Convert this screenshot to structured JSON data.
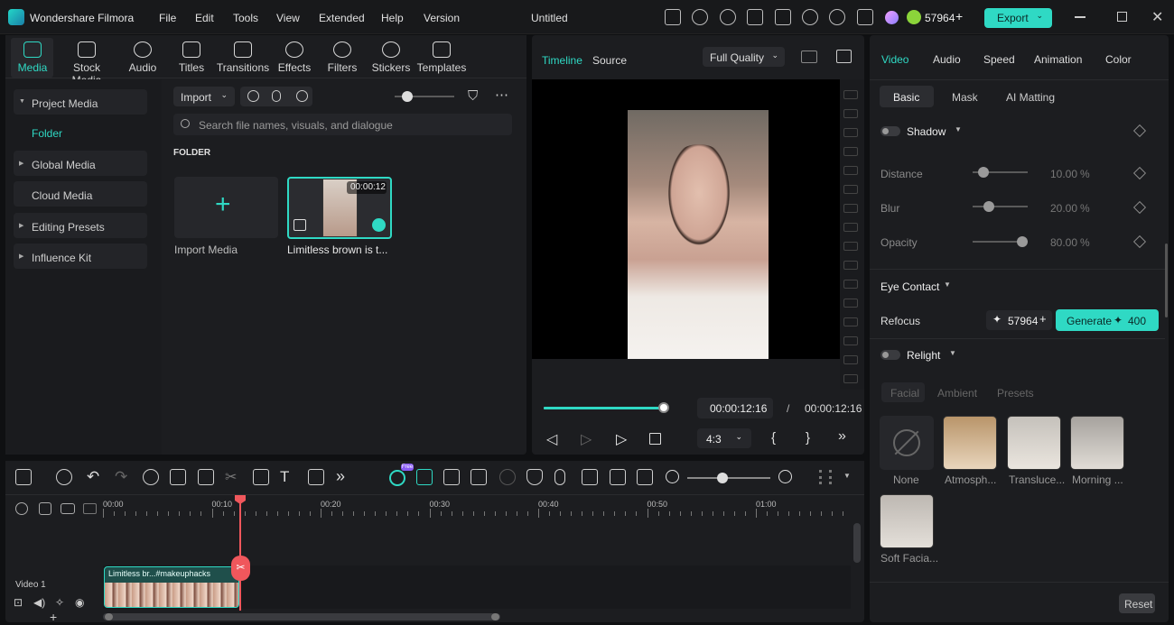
{
  "app": {
    "name": "Wondershare Filmora",
    "doc_title": "Untitled"
  },
  "menu": [
    "File",
    "Edit",
    "Tools",
    "View",
    "Extended",
    "Help",
    "Version"
  ],
  "credits": "57964",
  "export_label": "Export",
  "toolbar": [
    "Media",
    "Stock Media",
    "Audio",
    "Titles",
    "Transitions",
    "Effects",
    "Filters",
    "Stickers",
    "Templates"
  ],
  "sidebar": {
    "items": [
      {
        "label": "Project Media"
      },
      {
        "label": "Folder"
      },
      {
        "label": "Global Media"
      },
      {
        "label": "Cloud Media"
      },
      {
        "label": "Editing Presets"
      },
      {
        "label": "Influence Kit"
      }
    ]
  },
  "media": {
    "import_label": "Import",
    "search_placeholder": "Search file names, visuals, and dialogue",
    "folder_heading": "FOLDER",
    "import_media_label": "Import Media",
    "clip_name": "Limitless brown is t...",
    "clip_duration": "00:00:12"
  },
  "preview": {
    "tab_timeline": "Timeline",
    "tab_source": "Source",
    "quality": "Full Quality",
    "current_time": "00:00:12:16",
    "sep": "/",
    "total_time": "00:00:12:16",
    "aspect": "4:3",
    "progress": 1.0,
    "bracket_open": "{",
    "bracket_close": "}"
  },
  "inspector": {
    "tabs": [
      "Video",
      "Audio",
      "Speed",
      "Animation",
      "Color"
    ],
    "subtabs": [
      "Basic",
      "Mask",
      "AI Matting"
    ],
    "shadow_label": "Shadow",
    "distance": {
      "label": "Distance",
      "value": "10.00",
      "unit": "%",
      "level": 0.1
    },
    "blur": {
      "label": "Blur",
      "value": "20.00",
      "unit": "%",
      "level": 0.2
    },
    "opacity": {
      "label": "Opacity",
      "value": "80.00",
      "unit": "%",
      "level": 0.8
    },
    "eye_contact_label": "Eye Contact",
    "refocus_label": "Refocus",
    "refocus_credits": "57964",
    "generate_label": "Generate",
    "generate_cost": "400",
    "relight_label": "Relight",
    "relight_tabs": [
      "Facial",
      "Ambient",
      "Presets"
    ],
    "presets": [
      "None",
      "Atmosph...",
      "Transluce...",
      "Morning ...",
      "Soft Facia..."
    ],
    "reset_label": "Reset"
  },
  "timeline": {
    "ruler": [
      "00:00",
      "00:10",
      "00:20",
      "00:30",
      "00:40",
      "00:50",
      "01:00"
    ],
    "track_label": "Video 1",
    "clip_label": "Limitless br...#makeuphacks",
    "free_badge": "Free"
  },
  "colors": {
    "accent": "#2fd9c4",
    "playhead": "#f0575c"
  }
}
